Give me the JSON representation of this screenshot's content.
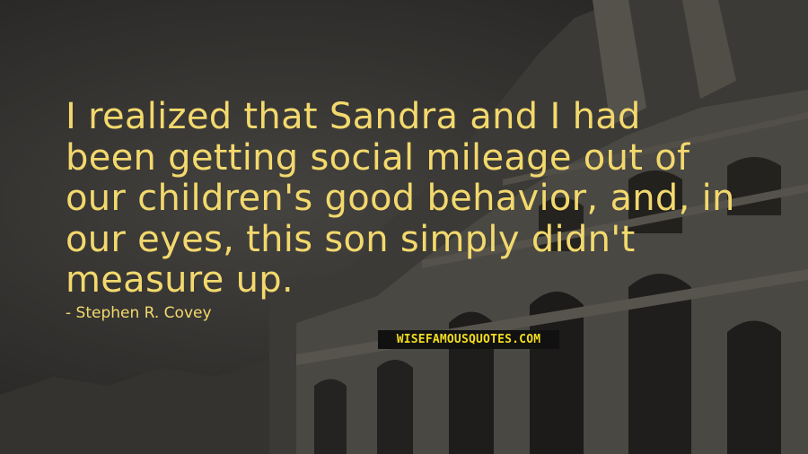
{
  "quote": {
    "lines": [
      "I realized that Sandra and I had",
      "been getting social mileage out of",
      "our children's good behavior, and, in",
      "our eyes, this son simply didn't",
      "measure up."
    ],
    "author": "Stephen R. Covey"
  },
  "watermark": {
    "part1": "WISEFAMOUS",
    "part2": "QUOTES.COM"
  },
  "colors": {
    "text": "#f3d96d",
    "background": "#2d2c2a",
    "watermark_bg": "#111111",
    "watermark_text": "#f2dc1e"
  }
}
